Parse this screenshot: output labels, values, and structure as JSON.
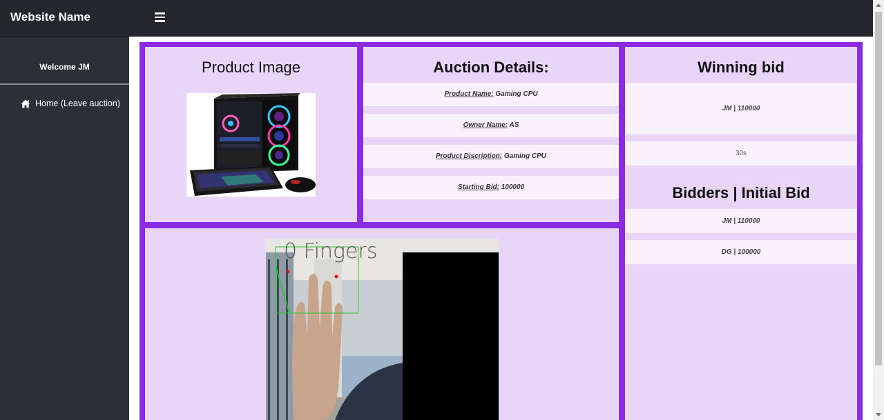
{
  "header": {
    "brand": "Website Name",
    "menu_icon": "hamburger-menu-icon"
  },
  "sidebar": {
    "welcome": "Welcome JM",
    "home_icon": "home-icon",
    "home_link": "Home (Leave auction)"
  },
  "product": {
    "title": "Product Image",
    "image": "gaming-pc-with-keyboard-and-mouse"
  },
  "details": {
    "title": "Auction Details:",
    "rows": [
      {
        "label": "Product Name:",
        "value": " Gaming CPU"
      },
      {
        "label": "Owner Name:",
        "value": " AS"
      },
      {
        "label": "Product Discription:",
        "value": " Gaming CPU"
      },
      {
        "label": "Starting Bid:",
        "value": " 100000"
      }
    ]
  },
  "winning": {
    "title": "Winning bid",
    "winner": "JM   | 110000",
    "timer": "30s"
  },
  "bidders": {
    "title": "Bidders   | Initial Bid",
    "rows": [
      {
        "text": "JM   | 110000"
      },
      {
        "text": "DG   | 100000"
      }
    ]
  },
  "camera": {
    "overlay_text": "0  Fingers",
    "overlay_color": "#555555",
    "box_color": "#22cc22",
    "marker_color": "#dd1111"
  },
  "colors": {
    "topbar": "#25272c",
    "sidebar": "#2c2f35",
    "border": "#8a2be2",
    "panel": "#e9d5f7",
    "row": "#f9f2fd"
  }
}
